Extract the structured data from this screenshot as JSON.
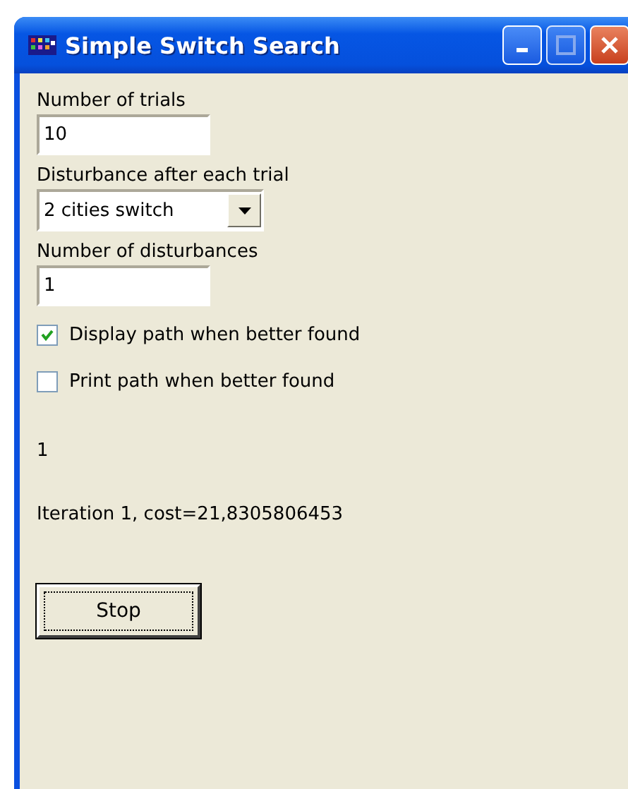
{
  "window": {
    "title": "Simple Switch Search"
  },
  "fields": [
    {
      "kind": "text",
      "label": "Number of trials",
      "value": "10"
    },
    {
      "kind": "select",
      "label": "Disturbance after each trial",
      "value": "2 cities switch"
    },
    {
      "kind": "text",
      "label": "Number of disturbances",
      "value": "1"
    }
  ],
  "checkboxes": [
    {
      "label": "Display path when better found",
      "checked": true
    },
    {
      "label": "Print path when better found",
      "checked": false
    }
  ],
  "outputs": [
    "1",
    "Iteration 1, cost=21,8305806453"
  ],
  "buttons": [
    {
      "label": "Stop"
    }
  ]
}
